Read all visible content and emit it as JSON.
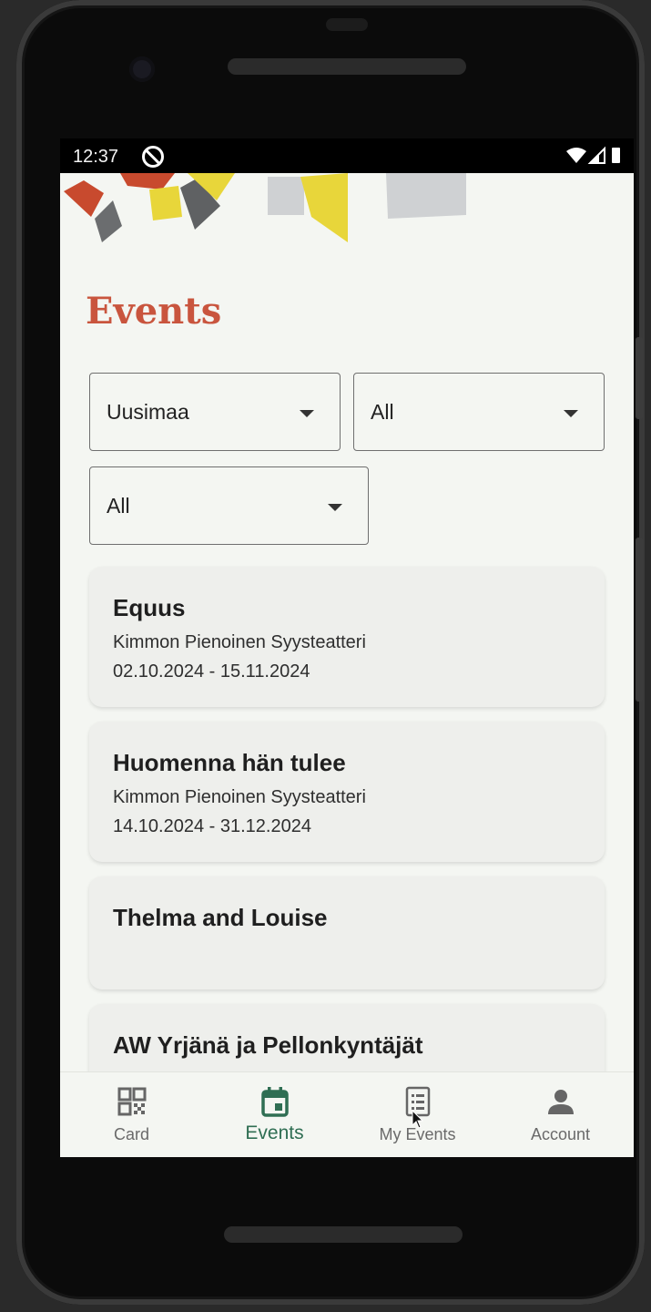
{
  "status_bar": {
    "time": "12:37"
  },
  "page": {
    "title": "Events"
  },
  "filters": [
    {
      "value": "Uusimaa"
    },
    {
      "value": "All"
    },
    {
      "value": "All"
    }
  ],
  "events": [
    {
      "title": "Equus",
      "venue": "Kimmon Pienoinen Syysteatteri",
      "dates": "02.10.2024 - 15.11.2024"
    },
    {
      "title": "Huomenna hän tulee",
      "venue": "Kimmon Pienoinen Syysteatteri",
      "dates": "14.10.2024 - 31.12.2024"
    },
    {
      "title": "Thelma and Louise",
      "venue": "",
      "dates": ""
    },
    {
      "title": "AW Yrjänä ja Pellonkyntäjät",
      "venue": "",
      "dates": ""
    }
  ],
  "bottom_nav": {
    "items": [
      {
        "label": "Card",
        "icon": "qr-code-icon"
      },
      {
        "label": "Events",
        "icon": "calendar-icon"
      },
      {
        "label": "My Events",
        "icon": "list-icon"
      },
      {
        "label": "Account",
        "icon": "person-icon"
      }
    ],
    "active": "Events"
  },
  "colors": {
    "title": "#c9553e",
    "accent": "#2f6e53",
    "background": "#f4f6f2",
    "card": "#eeefec"
  }
}
